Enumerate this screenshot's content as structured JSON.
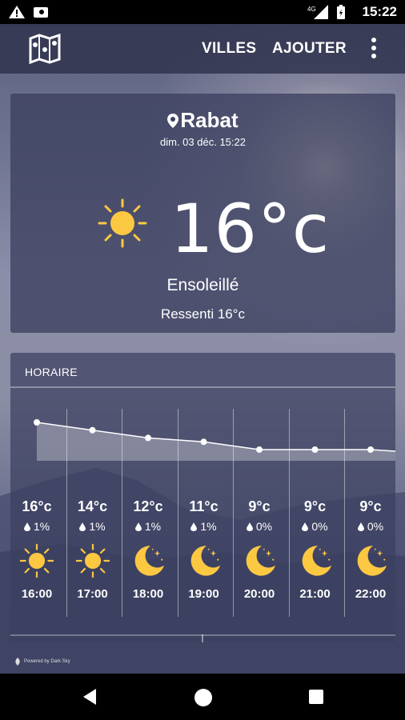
{
  "status_bar": {
    "time": "15:22",
    "network": "4G"
  },
  "app_bar": {
    "logo_icon": "map-icon",
    "villes_label": "VILLES",
    "ajouter_label": "AJOUTER",
    "more_icon": "more-vert-icon"
  },
  "current": {
    "city": "Rabat",
    "datetime": "dim. 03 déc. 15:22",
    "temperature": "16°c",
    "icon": "sun-icon",
    "condition": "Ensoleillé",
    "feels_like": "Ressenti 16°c"
  },
  "hourly": {
    "title": "HORAIRE",
    "items": [
      {
        "temp": "16°c",
        "precip": "1%",
        "icon": "sun-icon",
        "hour": "16:00"
      },
      {
        "temp": "14°c",
        "precip": "1%",
        "icon": "sun-icon",
        "hour": "17:00"
      },
      {
        "temp": "12°c",
        "precip": "1%",
        "icon": "moon-icon",
        "hour": "18:00"
      },
      {
        "temp": "11°c",
        "precip": "1%",
        "icon": "moon-icon",
        "hour": "19:00"
      },
      {
        "temp": "9°c",
        "precip": "0%",
        "icon": "moon-icon",
        "hour": "20:00"
      },
      {
        "temp": "9°c",
        "precip": "0%",
        "icon": "moon-icon",
        "hour": "21:00"
      },
      {
        "temp": "9°c",
        "precip": "0%",
        "icon": "moon-icon",
        "hour": "22:00"
      }
    ]
  },
  "powered_by": "Powered by Dark Sky",
  "colors": {
    "sun": "#fcc842",
    "moon": "#fcc842",
    "card": "#3c405f"
  }
}
